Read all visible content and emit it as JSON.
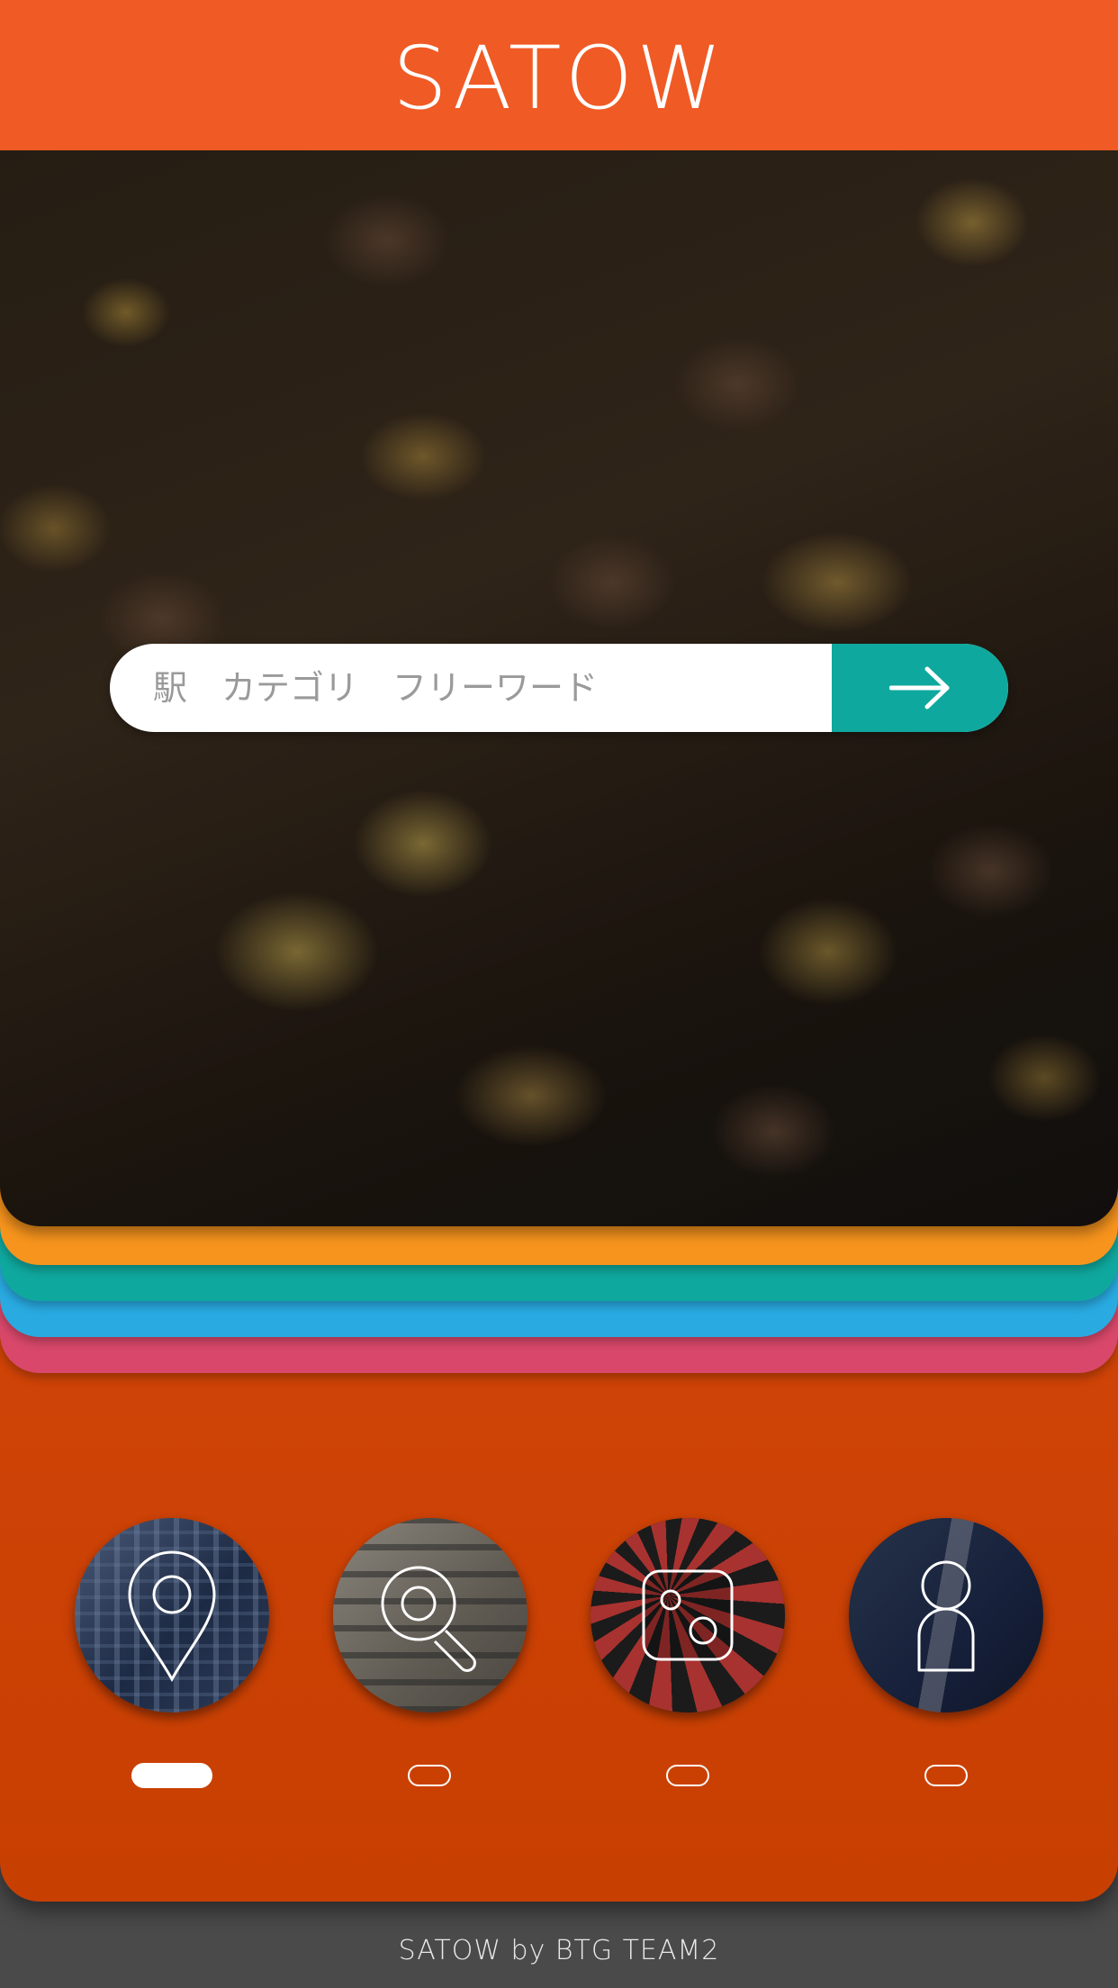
{
  "header": {
    "title": "SATOW",
    "color": "#f05a24"
  },
  "hero": {
    "image": "food-photo-steak-and-potatoes"
  },
  "search": {
    "placeholder": "駅　カテゴリ　フリーワード",
    "button_icon": "arrow-right-icon",
    "button_color": "#0fa89e"
  },
  "card_stack_colors": [
    "#f7941d",
    "#0fa89e",
    "#29abe2",
    "#d9486a"
  ],
  "nav": {
    "items": [
      {
        "name": "location",
        "icon": "map-pin-icon",
        "background": "city-buildings"
      },
      {
        "name": "search",
        "icon": "search-icon",
        "background": "dictionary-page"
      },
      {
        "name": "random",
        "icon": "dice-icon",
        "background": "roulette-wheel"
      },
      {
        "name": "profile",
        "icon": "person-icon",
        "background": "business-suit"
      }
    ],
    "active_index": 0
  },
  "footer": {
    "text": "SATOW by BTG TEAM2"
  }
}
